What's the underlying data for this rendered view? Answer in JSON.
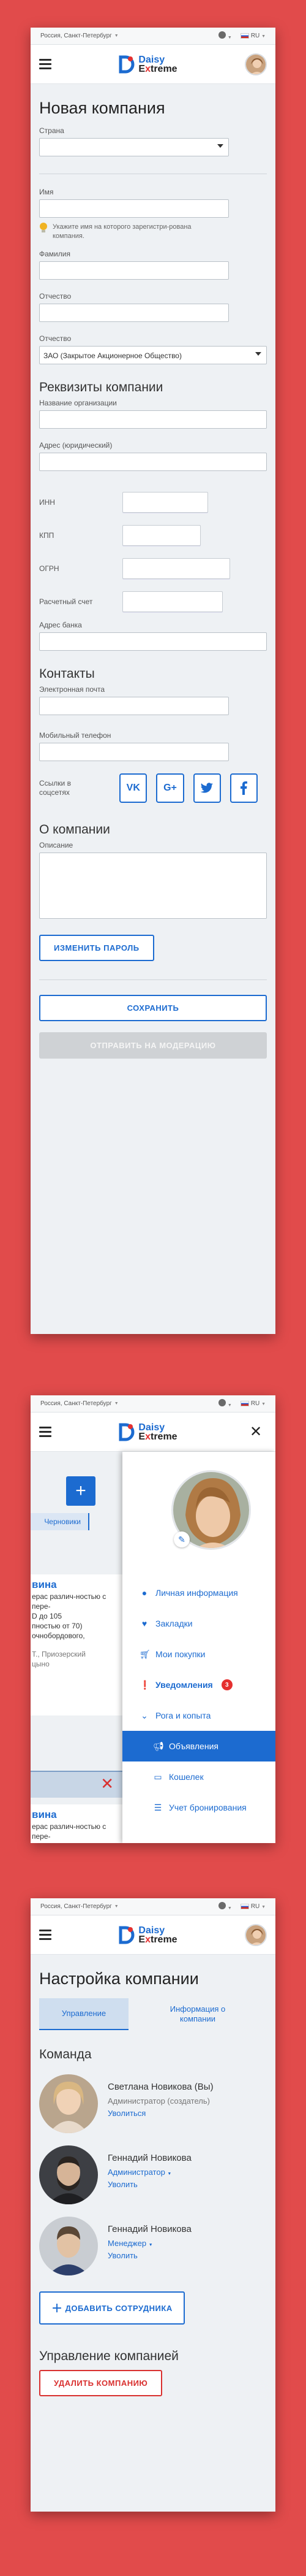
{
  "common": {
    "city": "Россия, Санкт-Петербург",
    "lang": "RU",
    "logo_line1": "Daisy",
    "logo_line2_a": "E",
    "logo_line2_x": "x",
    "logo_line2_b": "treme"
  },
  "form": {
    "title": "Новая компания",
    "country_label": "Страна",
    "name_label": "Имя",
    "name_hint": "Укажите имя на которого зарегистри-рована компания.",
    "surname_label": "Фамилия",
    "patronymic_label": "Отчество",
    "legal_form_label": "Отчество",
    "legal_form_value": "ЗАО (Закрытое Акционерное Общество)",
    "requisites_title": "Реквизиты компании",
    "org_name_label": "Название организации",
    "legal_address_label": "Адрес (юридический)",
    "inn_label": "ИНН",
    "kpp_label": "КПП",
    "ogrn_label": "ОГРН",
    "account_label": "Расчетный счет",
    "bank_address_label": "Адрес банка",
    "contacts_title": "Контакты",
    "email_label": "Электронная почта",
    "phone_label": "Мобильный телефон",
    "social_label": "Ссылки в соцсетях",
    "social": [
      "VK",
      "G+",
      "twitter-icon",
      "facebook-icon"
    ],
    "about_title": "О компании",
    "description_label": "Описание",
    "change_password": "ИЗМЕНИТЬ ПАРОЛЬ",
    "save": "СОХРАНИТЬ",
    "moderation": "ОТПРАВИТЬ НА МОДЕРАЦИЮ"
  },
  "menu_screen": {
    "drafts": "Черновики",
    "card1_title": "вина",
    "card1_text": "ерас различ-ностью с пере-\nD до 105\nпностью от 70)\nочнобордового,",
    "card1_meta": "Т., Приозерский\nцыно",
    "card2_title": "вина",
    "card2_text": "ерас различ-ностью с пере-\nD до 105",
    "items": [
      {
        "label": "Личная информация",
        "icon": "person-icon"
      },
      {
        "label": "Закладки",
        "icon": "heart-icon"
      },
      {
        "label": "Мои покупки",
        "icon": "cart-icon"
      },
      {
        "label": "Уведомления",
        "icon": "alert-icon",
        "badge": "3"
      },
      {
        "label": "Рога и копыта",
        "icon": "chevron-down-icon"
      },
      {
        "label": "Объявления",
        "icon": "megaphone-icon"
      },
      {
        "label": "Кошелек",
        "icon": "wallet-icon"
      },
      {
        "label": "Учет бронирования",
        "icon": "list-icon"
      }
    ]
  },
  "settings": {
    "title": "Настройка компании",
    "tab_manage": "Управление",
    "tab_info": "Информация о компании",
    "team_title": "Команда",
    "members": [
      {
        "name": "Светлана Новикова (Вы)",
        "role": "Администратор (создатель)",
        "action": "Уволиться"
      },
      {
        "name": "Геннадий Новикова",
        "role": "Администратор",
        "action": "Уволить"
      },
      {
        "name": "Геннадий Новикова",
        "role": "Менеджер",
        "action": "Уволить"
      }
    ],
    "add_employee": "ДОБАВИТЬ СОТРУДНИКА",
    "manage_title": "Управление компанией",
    "delete_company": "УДАЛИТЬ КОМПАНИЮ"
  }
}
